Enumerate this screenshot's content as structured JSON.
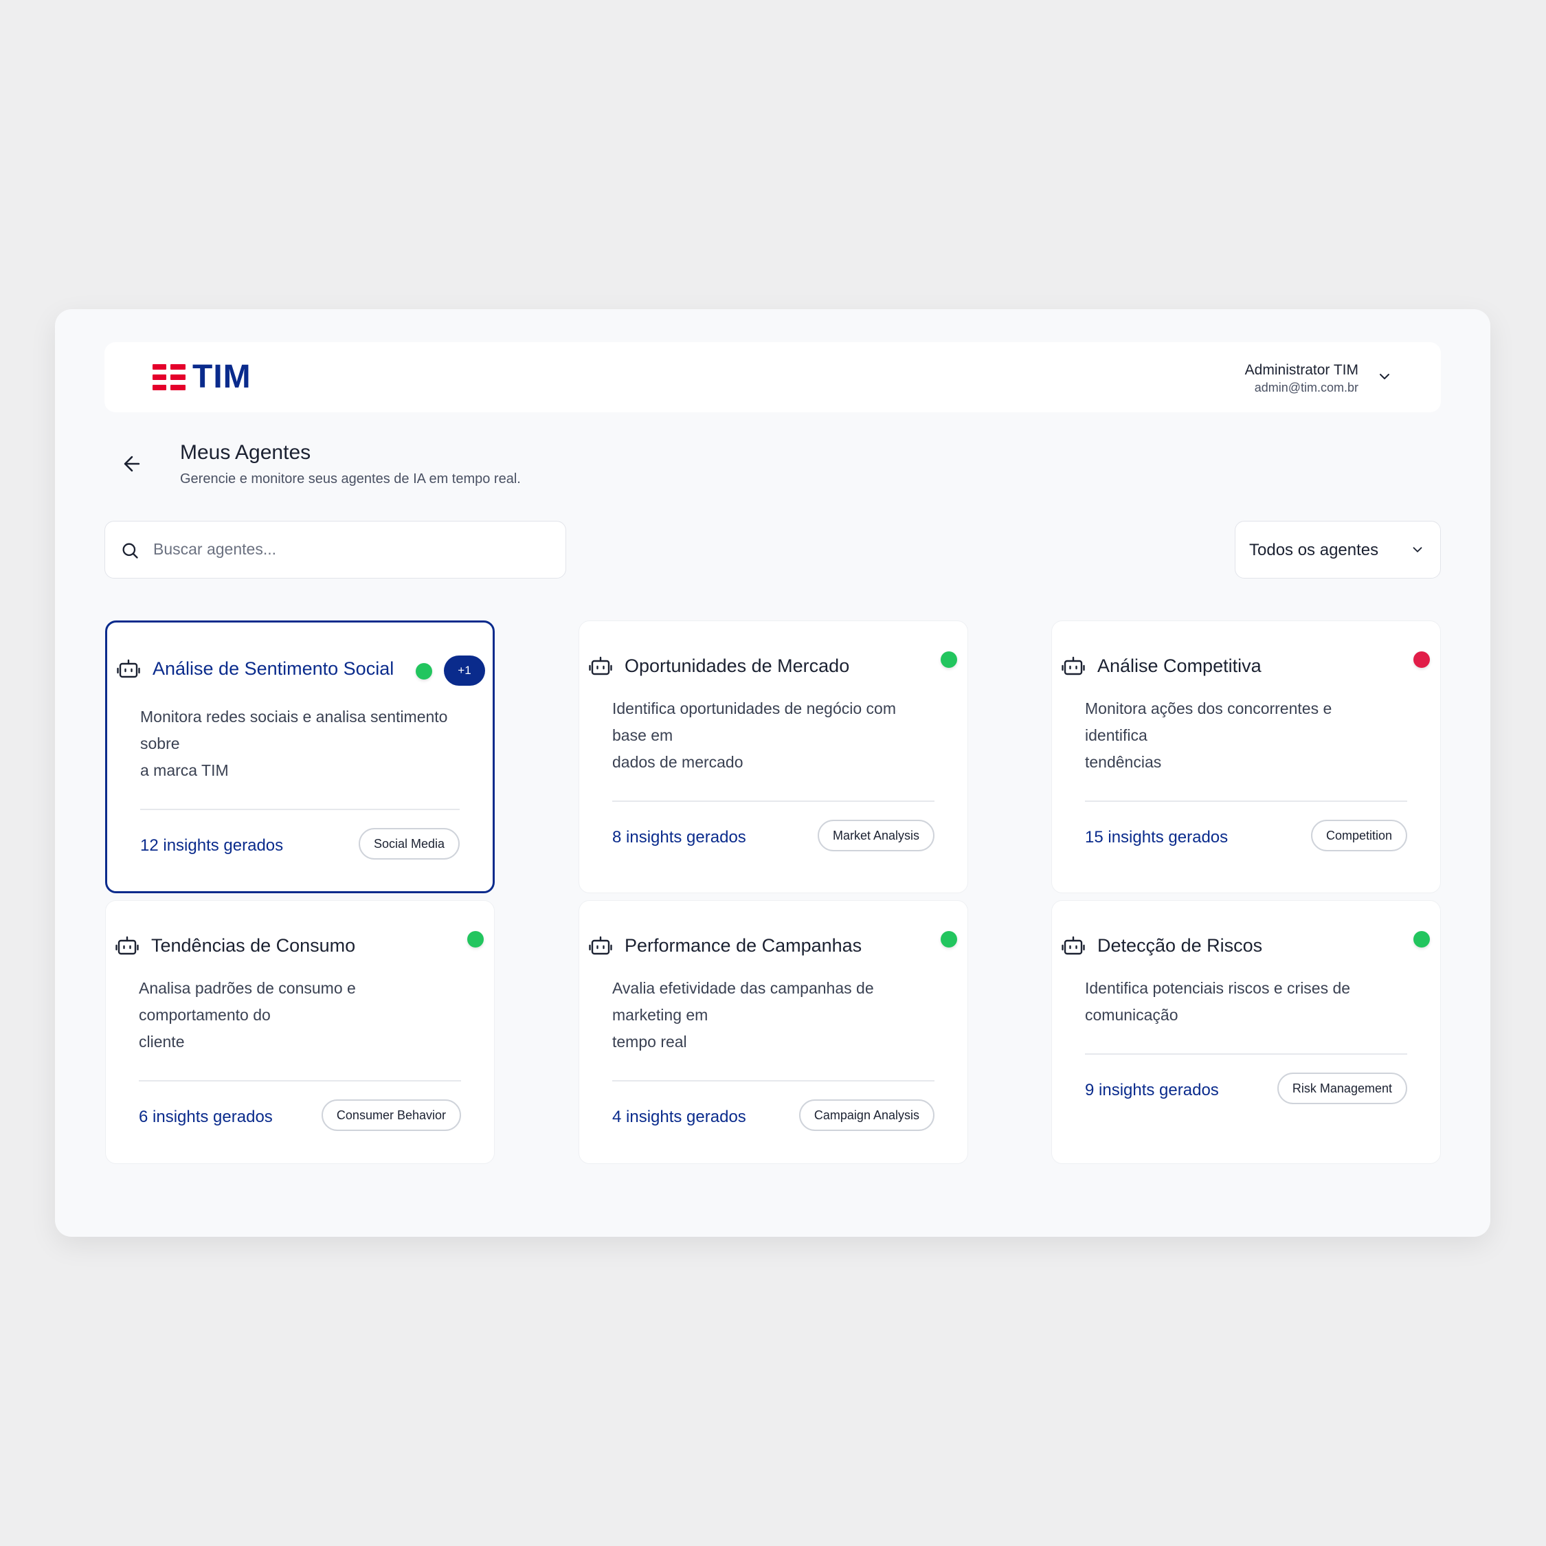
{
  "header": {
    "logo_text": "TIM",
    "user_name": "Administrator TIM",
    "user_email": "admin@tim.com.br"
  },
  "page": {
    "title": "Meus Agentes",
    "subtitle": "Gerencie e monitore seus agentes de IA em tempo real."
  },
  "search": {
    "placeholder": "Buscar agentes..."
  },
  "filter": {
    "selected": "Todos os agentes"
  },
  "colors": {
    "brand_blue": "#0a2b8c",
    "brand_red": "#e4002b",
    "status_active": "#22c55e",
    "status_inactive": "#e11d48"
  },
  "agents": [
    {
      "title": "Análise de Sentimento Social",
      "desc_lines": [
        "Monitora redes sociais e analisa sentimento",
        "sobre",
        "a marca TIM"
      ],
      "insights": "12 insights gerados",
      "tag": "Social Media",
      "status": "active",
      "badge": "+1",
      "selected": true
    },
    {
      "title": "Oportunidades de Mercado",
      "desc_lines": [
        "Identifica oportunidades de negócio com",
        "base em",
        "dados de mercado"
      ],
      "insights": "8 insights gerados",
      "tag": "Market Analysis",
      "status": "active"
    },
    {
      "title": "Análise Competitiva",
      "desc_lines": [
        "Monitora ações dos concorrentes e",
        "identifica",
        "tendências"
      ],
      "insights": "15 insights gerados",
      "tag": "Competition",
      "status": "inactive"
    },
    {
      "title": "Tendências de Consumo",
      "desc_lines": [
        "Analisa padrões de consumo e",
        "comportamento do",
        "cliente"
      ],
      "insights": "6 insights gerados",
      "tag": "Consumer Behavior",
      "status": "active"
    },
    {
      "title": "Performance de Campanhas",
      "desc_lines": [
        "Avalia efetividade das campanhas de",
        "marketing em",
        "tempo real"
      ],
      "insights": "4 insights gerados",
      "tag": "Campaign Analysis",
      "status": "active"
    },
    {
      "title": "Detecção de Riscos",
      "desc_lines": [
        "Identifica potenciais riscos e crises de",
        "comunicação"
      ],
      "insights": "9 insights gerados",
      "tag": "Risk Management",
      "status": "active"
    }
  ]
}
